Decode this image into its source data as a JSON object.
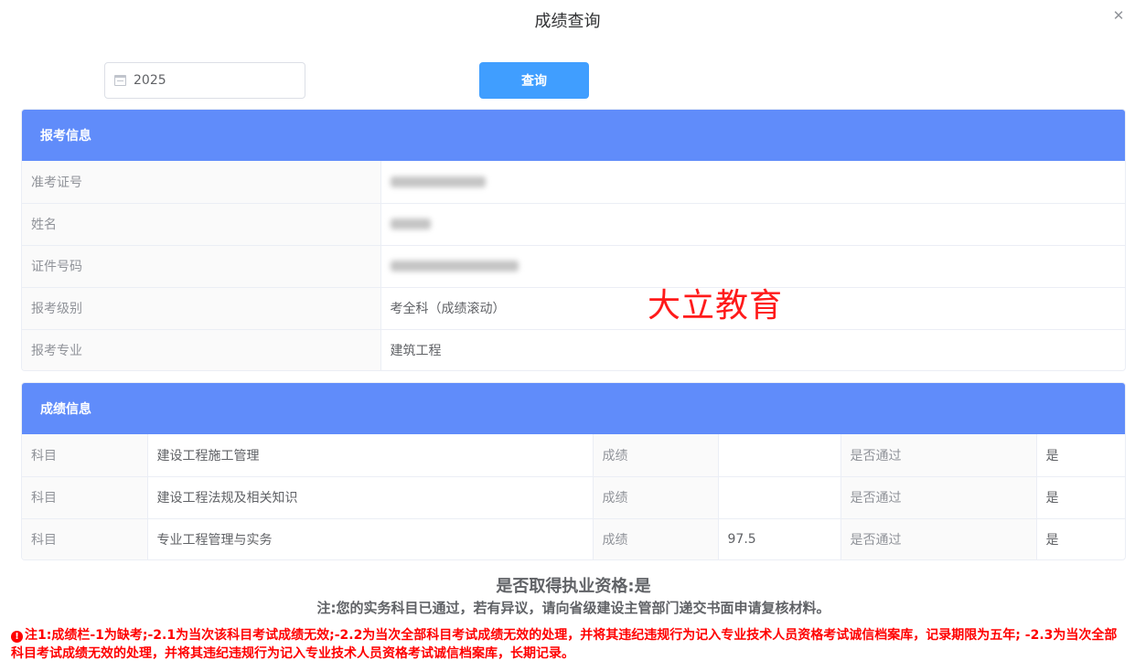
{
  "dialog": {
    "title": "成绩查询",
    "close_icon": "close-icon"
  },
  "search": {
    "year_value": "2025",
    "calendar_icon": "calendar-icon",
    "query_label": "查询"
  },
  "exam_info": {
    "header": "报考信息",
    "rows": [
      {
        "label": "准考证号",
        "value": ""
      },
      {
        "label": "姓名",
        "value": ""
      },
      {
        "label": "证件号码",
        "value": ""
      },
      {
        "label": "报考级别",
        "value": "考全科（成绩滚动）"
      },
      {
        "label": "报考专业",
        "value": "建筑工程"
      }
    ]
  },
  "watermark": "大立教育",
  "score_info": {
    "header": "成绩信息",
    "rows": [
      {
        "subject_label": "科目",
        "subject": "建设工程施工管理",
        "score_label": "成绩",
        "score": "",
        "pass_label": "是否通过",
        "pass": "是"
      },
      {
        "subject_label": "科目",
        "subject": "建设工程法规及相关知识",
        "score_label": "成绩",
        "score": "",
        "pass_label": "是否通过",
        "pass": "是"
      },
      {
        "subject_label": "科目",
        "subject": "专业工程管理与实务",
        "score_label": "成绩",
        "score": "97.5",
        "pass_label": "是否通过",
        "pass": "是"
      }
    ]
  },
  "qualification": "是否取得执业资格:是",
  "note": "注:您的实务科目已通过，若有异议，请向省级建设主管部门递交书面申请复核材料。",
  "warning": {
    "icon": "warning-icon",
    "text": "注1:成绩栏-1为缺考;-2.1为当次该科目考试成绩无效;-2.2为当次全部科目考试成绩无效的处理，并将其违纪违规行为记入专业技术人员资格考试诚信档案库，记录期限为五年; -2.3为当次全部科目考试成绩无效的处理，并将其违纪违规行为记入专业技术人员资格考试诚信档案库，长期记录。"
  },
  "colors": {
    "header_bg": "#608cfa",
    "button_bg": "#409eff",
    "warning": "#ff0000",
    "watermark": "#ff1a1a"
  }
}
